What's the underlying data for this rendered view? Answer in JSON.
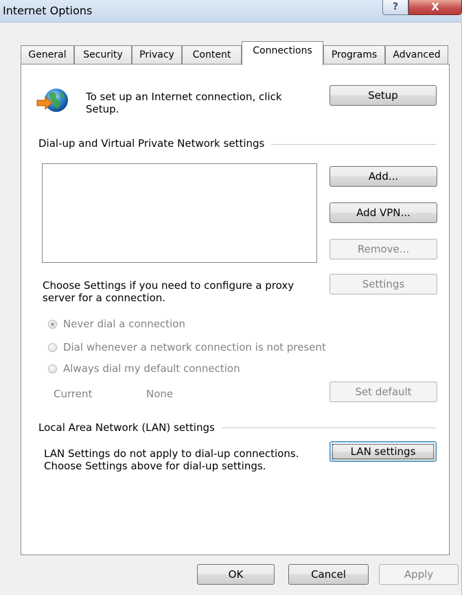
{
  "window": {
    "title": "Internet Options",
    "help_glyph": "?",
    "close_glyph": "X"
  },
  "tabs": [
    {
      "label": "General"
    },
    {
      "label": "Security"
    },
    {
      "label": "Privacy"
    },
    {
      "label": "Content"
    },
    {
      "label": "Connections",
      "active": true
    },
    {
      "label": "Programs"
    },
    {
      "label": "Advanced"
    }
  ],
  "setup": {
    "icon": "globe-network-icon",
    "text_line1": "To set up an Internet connection, click",
    "text_line2": "Setup.",
    "button": "Setup"
  },
  "dialup": {
    "group_title": "Dial-up and Virtual Private Network settings",
    "list_items": [],
    "add_button": "Add...",
    "add_vpn_button": "Add VPN...",
    "remove_button": "Remove...",
    "proxy_text_line1": "Choose Settings if you need to configure a proxy",
    "proxy_text_line2": "server for a connection.",
    "settings_button": "Settings",
    "radio_never": "Never dial a connection",
    "radio_whenever": "Dial whenever a network connection is not present",
    "radio_always": "Always dial my default connection",
    "selected_option": "never",
    "current_label": "Current",
    "current_value": "None",
    "set_default_button": "Set default"
  },
  "lan": {
    "group_title": "Local Area Network (LAN) settings",
    "text_line1": "LAN Settings do not apply to dial-up connections.",
    "text_line2": "Choose Settings above for dial-up settings.",
    "button": "LAN settings"
  },
  "footer": {
    "ok": "OK",
    "cancel": "Cancel",
    "apply": "Apply"
  }
}
